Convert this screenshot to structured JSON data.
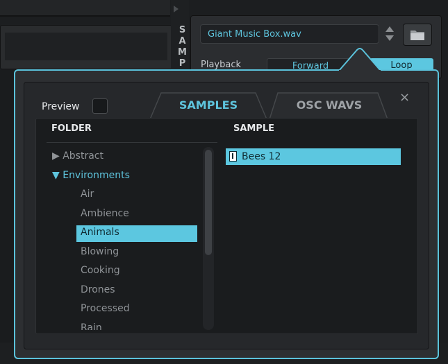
{
  "background": {
    "side_tab_label": "SAMP",
    "sample_file": "Giant Music Box.wav",
    "playback_label": "Playback",
    "playback_mode": "Forward",
    "loop_label": "Loop"
  },
  "browser": {
    "preview_label": "Preview",
    "tabs": [
      "SAMPLES",
      "OSC WAVS"
    ],
    "active_tab": "SAMPLES",
    "close_label": "×",
    "folder_header": "FOLDER",
    "sample_header": "SAMPLE",
    "folders": [
      {
        "label": "▶ Abstract",
        "state": "collapsed"
      },
      {
        "label": "▼ Environments",
        "state": "open"
      },
      {
        "label": "Air",
        "state": "child"
      },
      {
        "label": "Ambience",
        "state": "child"
      },
      {
        "label": "Animals",
        "state": "selected"
      },
      {
        "label": "Blowing",
        "state": "child"
      },
      {
        "label": "Cooking",
        "state": "child"
      },
      {
        "label": "Drones",
        "state": "child"
      },
      {
        "label": "Processed",
        "state": "child"
      },
      {
        "label": "Rain",
        "state": "child"
      }
    ],
    "samples": [
      "Bees 12"
    ],
    "selected_sample": "Bees 12"
  },
  "colors": {
    "accent": "#5cc7e0",
    "panel": "#2d2f32",
    "list_bg": "#1a1c1e"
  }
}
